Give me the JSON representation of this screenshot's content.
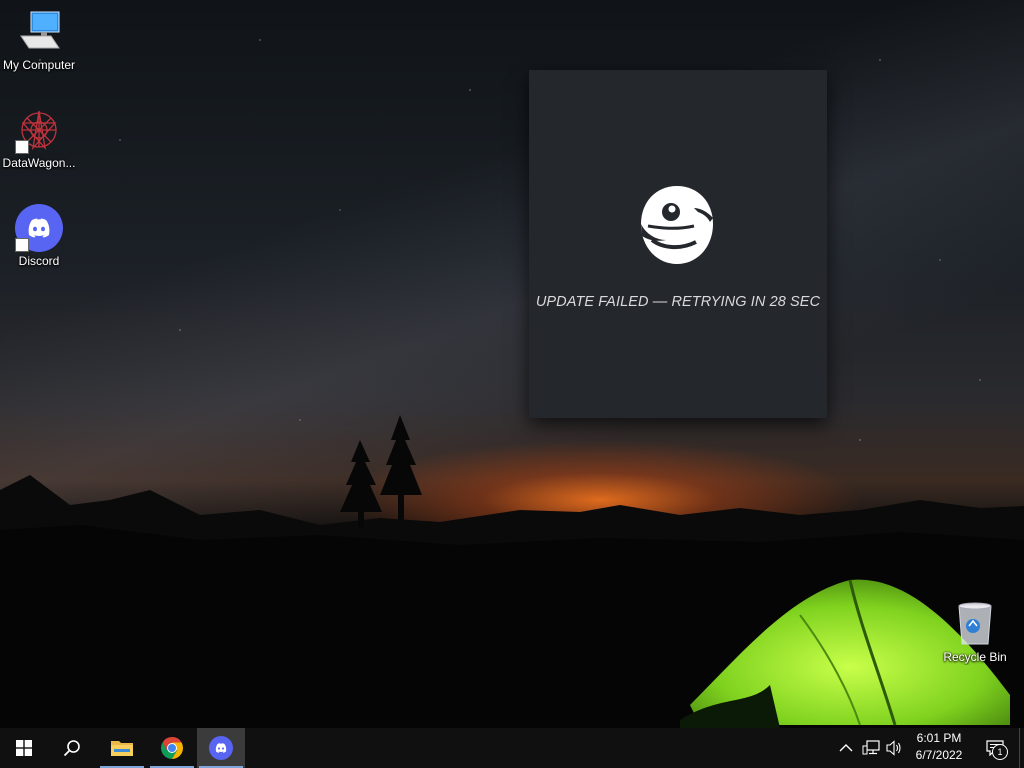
{
  "desktop": {
    "icons": [
      {
        "label": "My Computer",
        "icon": "computer-icon"
      },
      {
        "label": "DataWagon...",
        "icon": "datawagon-icon"
      },
      {
        "label": "Discord",
        "icon": "discord-icon"
      },
      {
        "label": "Recycle Bin",
        "icon": "recycle-bin-icon"
      }
    ]
  },
  "splash": {
    "status": "UPDATE FAILED — RETRYING IN 28 SEC",
    "logo": "discord-wumpus-logo"
  },
  "taskbar": {
    "apps": [
      {
        "name": "start",
        "icon": "windows-logo-icon"
      },
      {
        "name": "search",
        "icon": "search-icon"
      },
      {
        "name": "file-explorer",
        "icon": "folder-icon"
      },
      {
        "name": "chrome",
        "icon": "chrome-icon"
      },
      {
        "name": "discord",
        "icon": "discord-icon",
        "active": true
      }
    ],
    "tray": {
      "time": "6:01 PM",
      "date": "6/7/2022",
      "notification_count": "1"
    }
  },
  "colors": {
    "taskbar": "#101010",
    "splash_bg": "#24272c",
    "discord_blurple": "#5865f2",
    "active_underline": "#7fa6d8"
  }
}
